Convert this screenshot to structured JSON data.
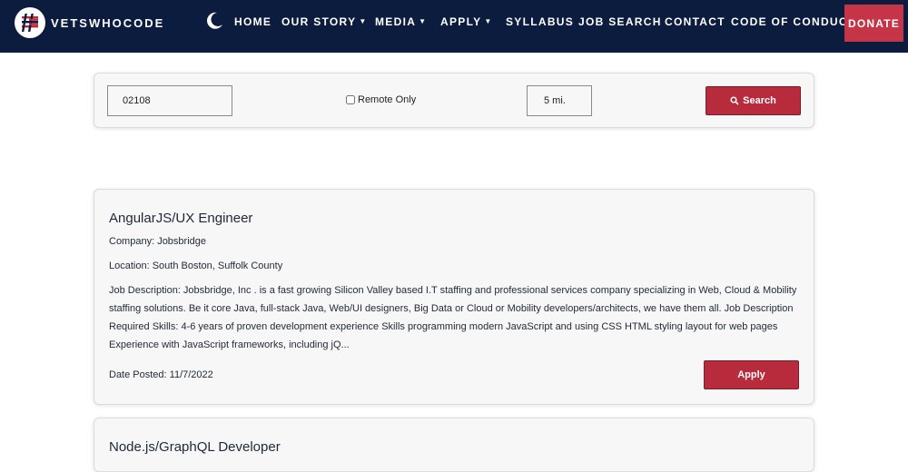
{
  "nav": {
    "brand": "VETSWHOCODE",
    "links": [
      {
        "label": "HOME"
      },
      {
        "label": "OUR STORY",
        "dropdown": true
      },
      {
        "label": "MEDIA",
        "dropdown": true
      },
      {
        "label": "APPLY",
        "dropdown": true
      },
      {
        "label": "SYLLABUS"
      },
      {
        "label": "JOB SEARCH"
      },
      {
        "label": "CONTACT"
      },
      {
        "label": "CODE OF CONDUCT"
      }
    ],
    "donate": "DONATE",
    "caret": "▼",
    "theme_icon": "moon-icon"
  },
  "search": {
    "zip_value": "02108",
    "remote_label": "Remote Only",
    "remote_checked": false,
    "radius_value": "5 mi.",
    "button_label": "Search",
    "button_icon": "search-icon"
  },
  "jobs": [
    {
      "title": "AngularJS/UX Engineer",
      "company": "Company: Jobsbridge",
      "location": "Location: South Boston, Suffolk County",
      "description": "Job Description: Jobsbridge, Inc . is a fast growing Silicon Valley based I.T staffing and professional services company specializing in Web, Cloud & Mobility staffing solutions. Be it core Java, full-stack Java, Web/UI designers, Big Data or Cloud or Mobility developers/architects, we have them all. Job Description Required Skills: 4-6 years of proven development experience Skills programming modern JavaScript and using CSS HTML styling layout for web pages Experience with JavaScript frameworks, including jQ...",
      "date_posted": "Date Posted: 11/7/2022",
      "apply_label": "Apply"
    },
    {
      "title": "Node.js/GraphQL Developer"
    }
  ],
  "colors": {
    "nav_bg": "#0b1c3e",
    "accent": "#b72b3d",
    "donate_bg": "#c53547",
    "card_bg": "#f7f7f7"
  }
}
